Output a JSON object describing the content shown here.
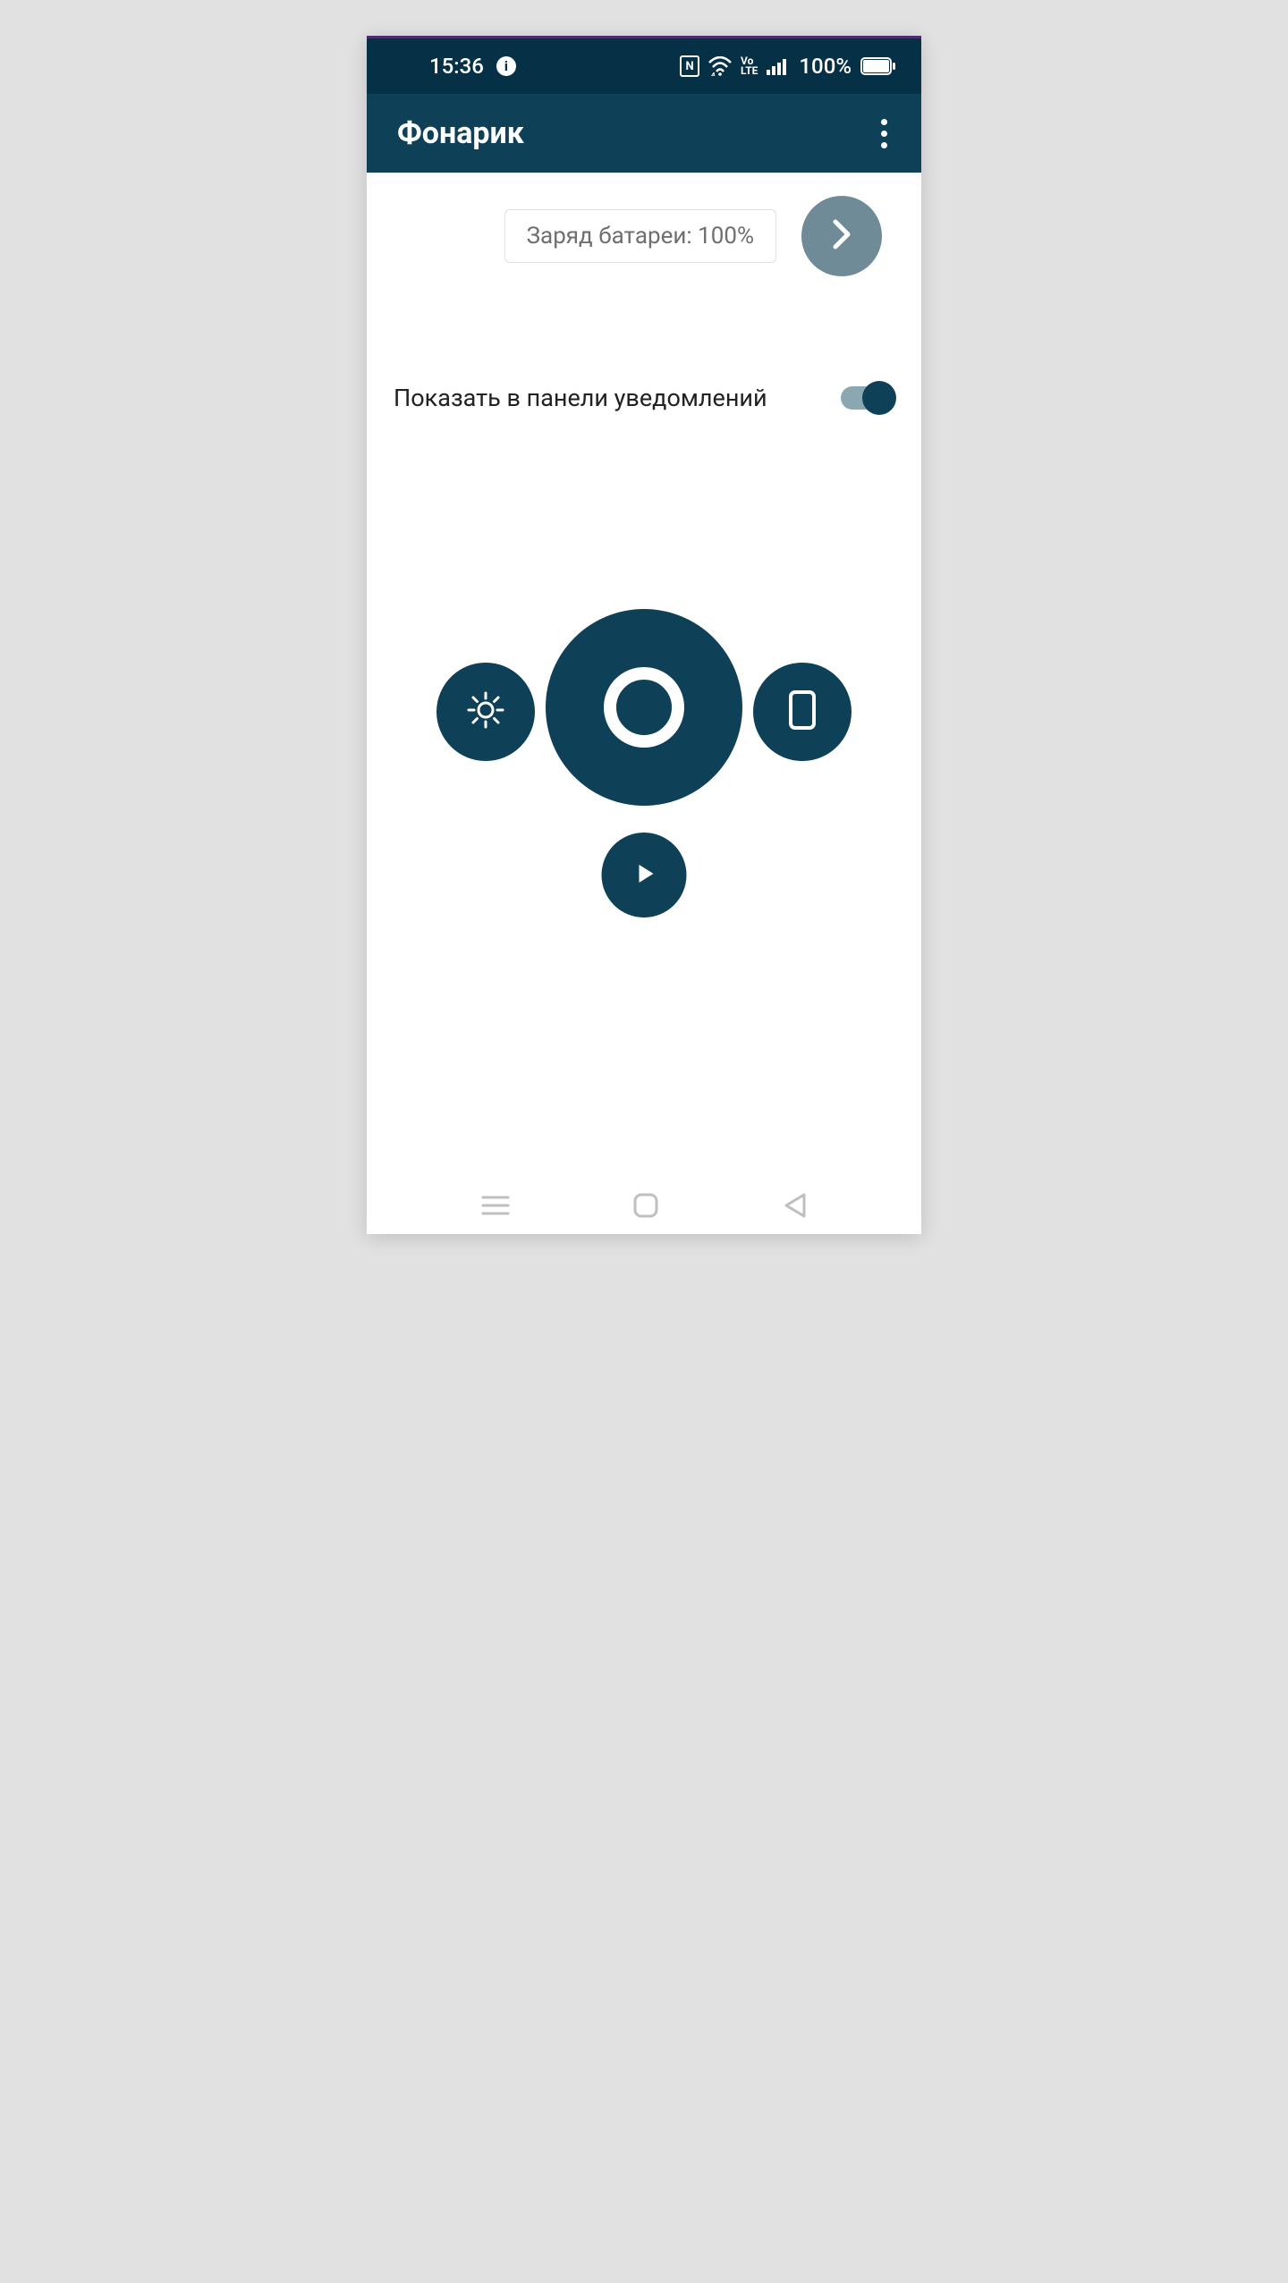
{
  "status": {
    "time": "15:36",
    "battery_text": "100%"
  },
  "app": {
    "title": "Фонарик"
  },
  "battery_card": "Заряд батареи: 100%",
  "toggle": {
    "label": "Показать в панели уведомлений"
  }
}
